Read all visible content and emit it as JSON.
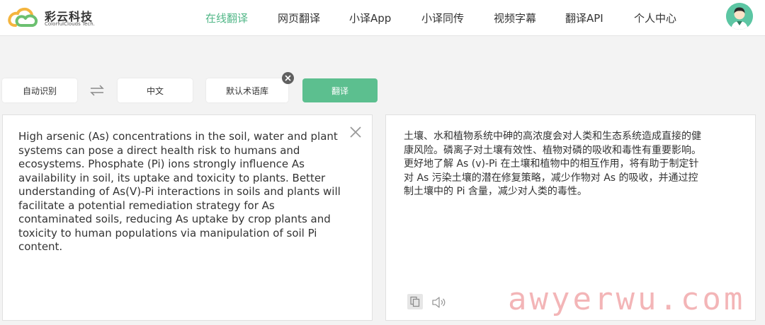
{
  "brand": {
    "name_cn": "彩云科技",
    "name_en": "ColorfulClouds Tech."
  },
  "nav": {
    "items": [
      {
        "label": "在线翻译",
        "active": true
      },
      {
        "label": "网页翻译",
        "active": false
      },
      {
        "label": "小译App",
        "active": false
      },
      {
        "label": "小译同传",
        "active": false
      },
      {
        "label": "视频字幕",
        "active": false
      },
      {
        "label": "翻译API",
        "active": false
      },
      {
        "label": "个人中心",
        "active": false
      }
    ]
  },
  "toolbar": {
    "source_lang": "自动识别",
    "swap_icon": "swap-arrows-icon",
    "target_lang": "中文",
    "glossary": "默认术语库",
    "translate": "翻译"
  },
  "source": {
    "text": "High arsenic (As) concentrations in the soil, water and plant\nsystems can pose a direct health risk to humans and\necosystems. Phosphate (Pi) ions strongly influence As\navailability in soil, its uptake and toxicity to plants. Better\nunderstanding of As(V)-Pi interactions in soils and plants will\nfacilitate a potential remediation strategy for As\ncontaminated soils, reducing As uptake by crop plants and\ntoxicity to human populations via manipulation of soil Pi\ncontent."
  },
  "target": {
    "text": "土壤、水和植物系统中砷的高浓度会对人类和生态系统造成直接的健\n康风险。磷离子对土壤有效性、植物对磷的吸收和毒性有重要影响。\n更好地了解 As (v)-Pi 在土壤和植物中的相互作用，将有助于制定针\n对 As 污染土壤的潜在修复策略，减少作物对 As 的吸收，并通过控\n制土壤中的 Pi 含量，减少对人类的毒性。"
  },
  "watermark": "awyerwu.com",
  "colors": {
    "accent": "#52b788",
    "translate_button": "#5cbf8f",
    "avatar_bg": "#5cc6a3",
    "watermark": "#f2a9ab"
  }
}
